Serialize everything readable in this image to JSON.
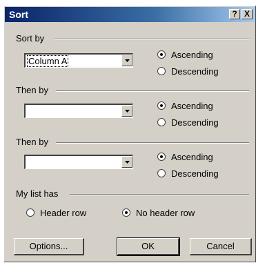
{
  "dialog": {
    "title": "Sort",
    "help_label": "?",
    "close_label": "X"
  },
  "sort_by": {
    "label": "Sort by",
    "selected": "Column A",
    "ascending": "Ascending",
    "descending": "Descending",
    "order": "Ascending"
  },
  "then_by_1": {
    "label": "Then by",
    "selected": "",
    "ascending": "Ascending",
    "descending": "Descending",
    "order": "Ascending"
  },
  "then_by_2": {
    "label": "Then by",
    "selected": "",
    "ascending": "Ascending",
    "descending": "Descending",
    "order": "Ascending"
  },
  "my_list_has": {
    "label": "My list has",
    "header_row": "Header row",
    "no_header_row": "No header row",
    "selected": "No header row"
  },
  "buttons": {
    "options": "Options...",
    "ok": "OK",
    "cancel": "Cancel"
  }
}
